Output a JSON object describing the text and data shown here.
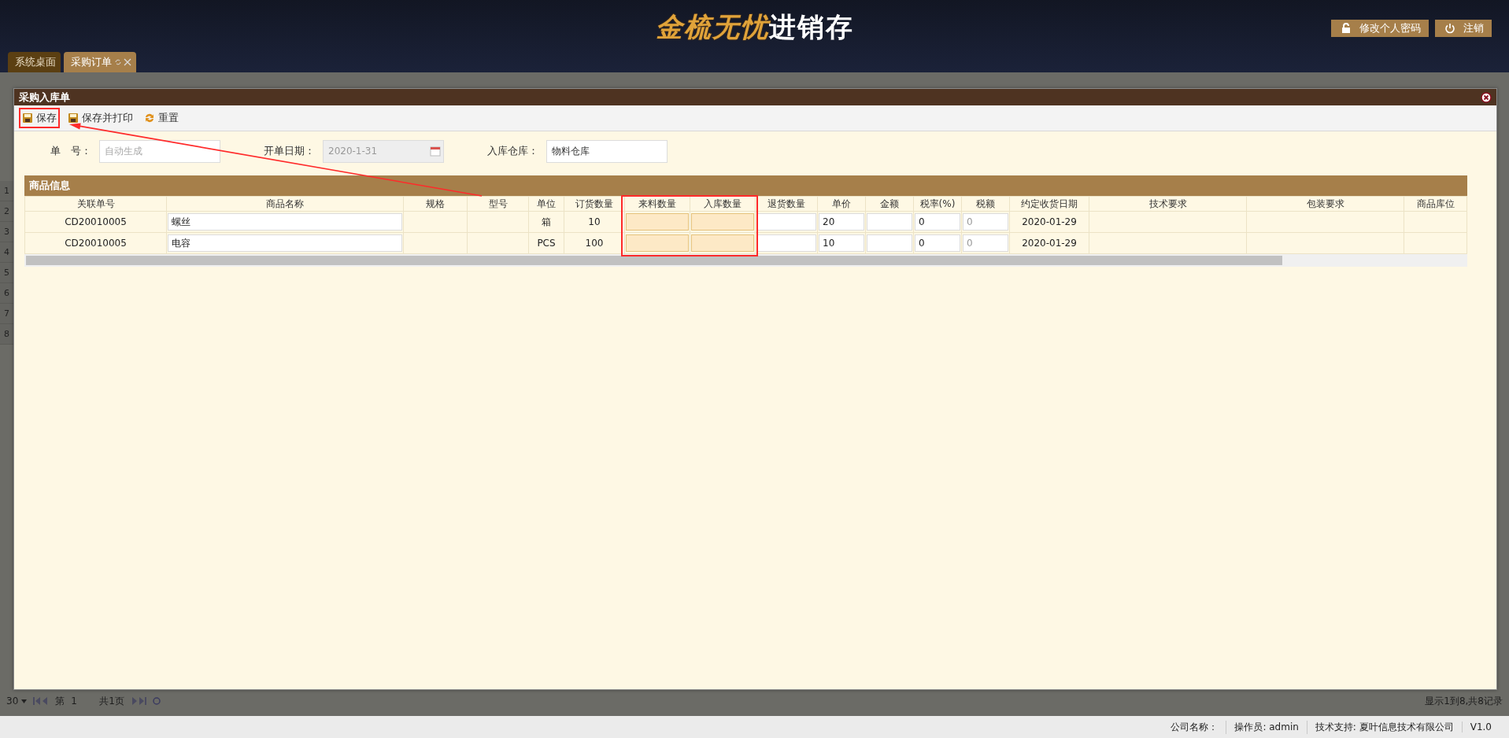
{
  "header": {
    "logo": {
      "gold": "金梳无忧",
      "white": "进销存"
    },
    "buttons": [
      {
        "kind": "lock",
        "label": "修改个人密码"
      },
      {
        "kind": "power",
        "label": "注销"
      }
    ]
  },
  "tabs": [
    {
      "label": "系统桌面",
      "selected": false,
      "closable": false
    },
    {
      "label": "采购订单",
      "selected": true,
      "closable": true
    }
  ],
  "background_grid": {
    "row_numbers": [
      "1",
      "2",
      "3",
      "4",
      "5",
      "6",
      "7",
      "8"
    ],
    "pager": {
      "page_size": "30",
      "page_label": "第",
      "page": "1",
      "total_pages": "共1页",
      "summary": "显示1到8,共8记录"
    }
  },
  "dialog": {
    "title": "采购入库单",
    "toolbar": [
      {
        "kind": "save",
        "label": "保存",
        "highlighted": true
      },
      {
        "kind": "save",
        "label": "保存并打印",
        "highlighted": false
      },
      {
        "kind": "reset",
        "label": "重置",
        "highlighted": false
      }
    ],
    "form": [
      {
        "label": "单　号：",
        "placeholder": "自动生成",
        "disabled": false,
        "calendar": false
      },
      {
        "label": "开单日期：",
        "value": "2020-1-31",
        "disabled": true,
        "calendar": true
      },
      {
        "label": "入库仓库：",
        "value": "物料仓库",
        "disabled": false,
        "calendar": false
      }
    ],
    "table": {
      "title": "商品信息",
      "columns": [
        {
          "label": "关联单号",
          "highlighted": false
        },
        {
          "label": "商品名称",
          "highlighted": false
        },
        {
          "label": "规格",
          "highlighted": false
        },
        {
          "label": "型号",
          "highlighted": false
        },
        {
          "label": "单位",
          "highlighted": false
        },
        {
          "label": "订货数量",
          "highlighted": false
        },
        {
          "label": "来料数量",
          "highlighted": true
        },
        {
          "label": "入库数量",
          "highlighted": true
        },
        {
          "label": "退货数量",
          "highlighted": false
        },
        {
          "label": "单价",
          "highlighted": false
        },
        {
          "label": "金额",
          "highlighted": false
        },
        {
          "label": "税率(%)",
          "highlighted": false
        },
        {
          "label": "税额",
          "highlighted": false
        },
        {
          "label": "约定收货日期",
          "highlighted": false
        },
        {
          "label": "技术要求",
          "highlighted": false
        },
        {
          "label": "包装要求",
          "highlighted": false
        },
        {
          "label": "商品库位",
          "highlighted": false
        }
      ],
      "rows": [
        [
          {
            "kind": "text",
            "text": "CD20010005"
          },
          {
            "kind": "input",
            "text": "螺丝"
          },
          {
            "kind": "text"
          },
          {
            "kind": "text"
          },
          {
            "kind": "text",
            "text": "箱"
          },
          {
            "kind": "text",
            "text": "10"
          },
          {
            "kind": "input",
            "highlighted": true
          },
          {
            "kind": "input",
            "highlighted": true
          },
          {
            "kind": "input"
          },
          {
            "kind": "input",
            "text": "20"
          },
          {
            "kind": "input"
          },
          {
            "kind": "input",
            "text": "0"
          },
          {
            "kind": "readonly",
            "text": "0"
          },
          {
            "kind": "text",
            "text": "2020-01-29"
          },
          {
            "kind": "text"
          },
          {
            "kind": "text"
          },
          {
            "kind": "text"
          }
        ],
        [
          {
            "kind": "text",
            "text": "CD20010005"
          },
          {
            "kind": "input",
            "text": "电容"
          },
          {
            "kind": "text"
          },
          {
            "kind": "text"
          },
          {
            "kind": "text",
            "text": "PCS"
          },
          {
            "kind": "text",
            "text": "100"
          },
          {
            "kind": "input",
            "highlighted": true
          },
          {
            "kind": "input",
            "highlighted": true
          },
          {
            "kind": "input"
          },
          {
            "kind": "input",
            "text": "10"
          },
          {
            "kind": "input"
          },
          {
            "kind": "input",
            "text": "0"
          },
          {
            "kind": "readonly",
            "text": "0"
          },
          {
            "kind": "text",
            "text": "2020-01-29"
          },
          {
            "kind": "text"
          },
          {
            "kind": "text"
          },
          {
            "kind": "text"
          }
        ]
      ]
    },
    "annotations": [
      {
        "kind": "arrow"
      }
    ]
  },
  "status_bar": [
    "公司名称：",
    "操作员: admin",
    "技术支持: 夏叶信息技术有限公司",
    "V1.0"
  ]
}
